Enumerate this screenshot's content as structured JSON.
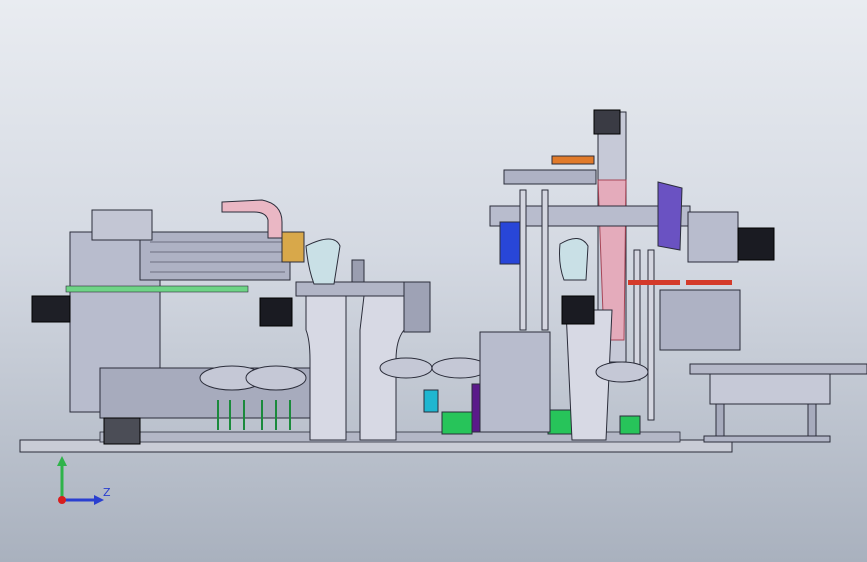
{
  "viewport": {
    "background_top": "#e9ecf1",
    "background_bottom": "#a9b1be"
  },
  "model": {
    "description_icon": "assembly-machine-model",
    "colors": {
      "body": "#b8bccd",
      "frame": "#8a8fa6",
      "outline": "#2b2d3a",
      "accent_green": "#27c45a",
      "accent_purple": "#5a1a8a",
      "accent_blue": "#2846d8",
      "accent_orange": "#e07a2a",
      "accent_pink": "#e6a0b4",
      "accent_cyan": "#1fb6d0",
      "base_plate": "#c9ccd6"
    }
  },
  "triad": {
    "z_label": "Z",
    "y_color": "#2fb34a",
    "z_color": "#2a3fd0",
    "origin_color": "#d81e1e"
  }
}
